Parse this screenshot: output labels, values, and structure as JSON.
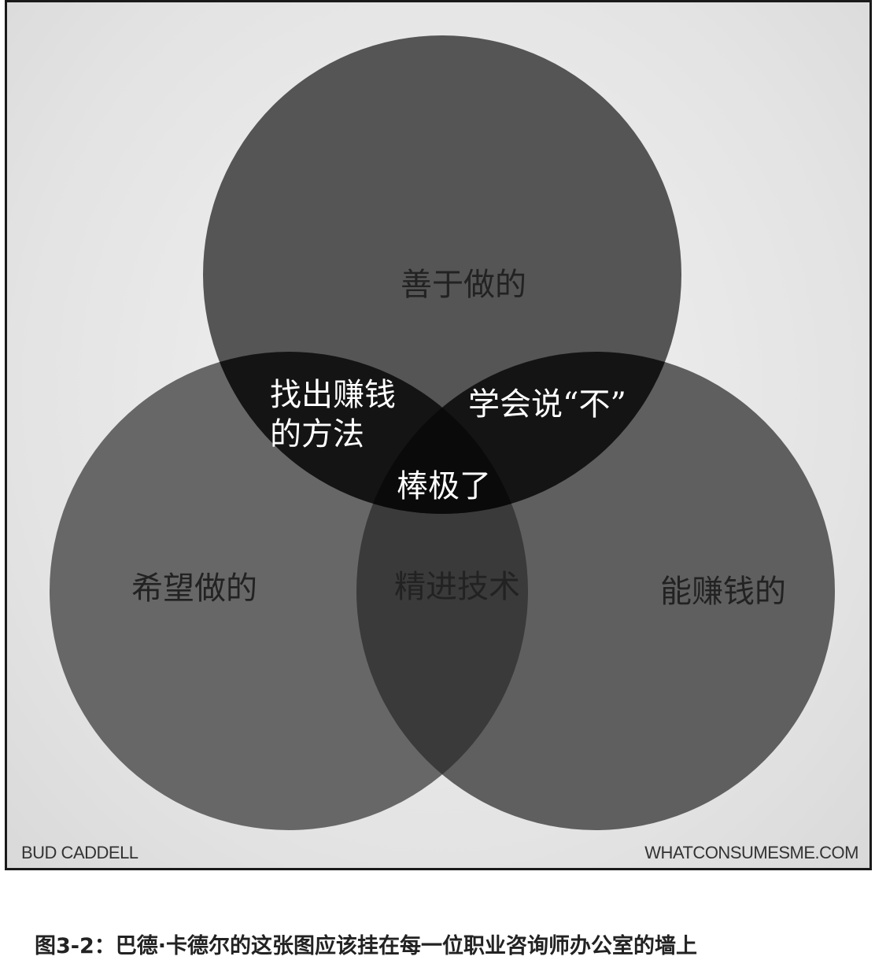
{
  "labels": {
    "good_at": "善于做的",
    "want_to": "希望做的",
    "paid_for": "能赚钱的",
    "find_way_line1": "找出赚钱",
    "find_way_line2": "的方法",
    "learn_no": "学会说“不”",
    "sweet_spot": "棒极了",
    "improve": "精进技术"
  },
  "credits": {
    "author": "BUD CADDELL",
    "website": "WHATCONSUMESME.COM"
  },
  "caption": "图3-2：巴德·卡德尔的这张图应该挂在每一位职业咨询师办公室的墙上",
  "colors": {
    "circle": "#555555",
    "triple_overlap": "#0a0a0a",
    "top_pair_overlap": "#111111",
    "label_dark": "#222222",
    "label_light": "#ffffff"
  }
}
